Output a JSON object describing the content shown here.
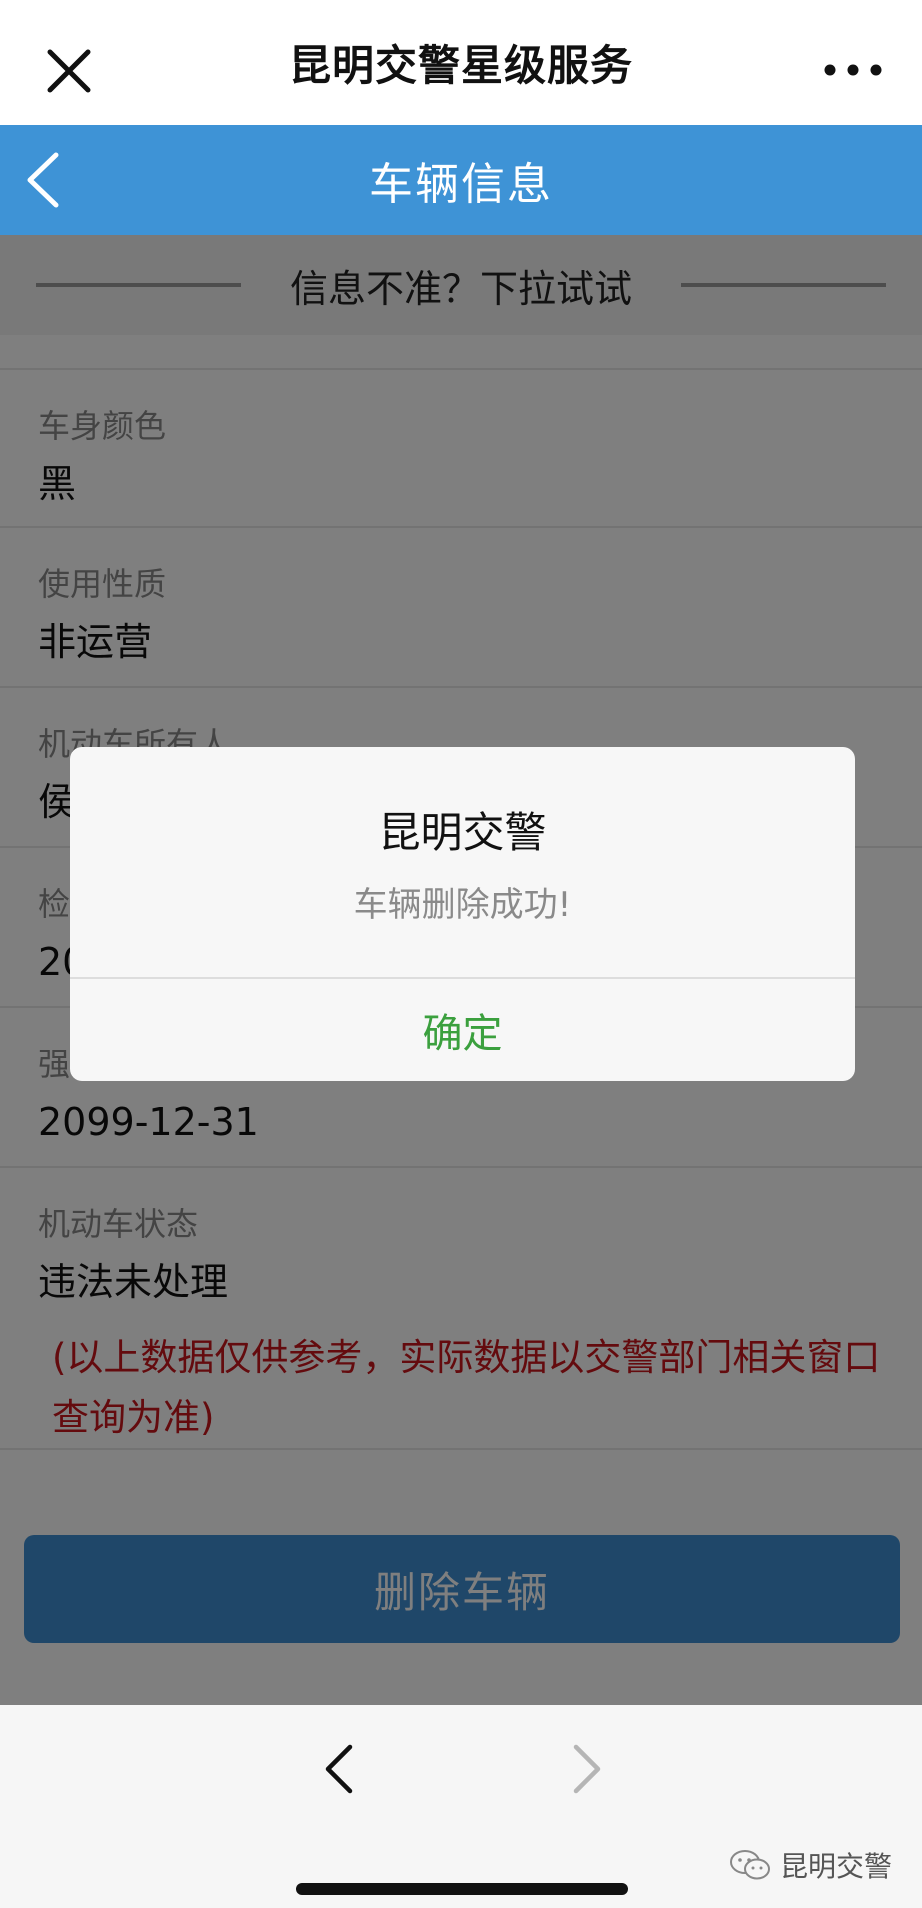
{
  "wechat_bar": {
    "title": "昆明交警星级服务"
  },
  "app_header": {
    "title": "车辆信息"
  },
  "pull_hint": "信息不准？下拉试试",
  "vehicle_info": {
    "items": [
      {
        "label": "车身颜色",
        "value": "黑"
      },
      {
        "label": "使用性质",
        "value": "非运营"
      },
      {
        "label": "机动车所有人",
        "value": "侯"
      },
      {
        "label": "检",
        "value": "20"
      },
      {
        "label": "强",
        "value": "2099-12-31"
      },
      {
        "label": "机动车状态",
        "value": "违法未处理"
      }
    ],
    "disclaimer": "(以上数据仅供参考，实际数据以交警部门相关窗口查询为准)"
  },
  "delete_button": {
    "label": "删除车辆"
  },
  "dialog": {
    "title": "昆明交警",
    "message": "车辆删除成功!",
    "confirm_label": "确定"
  },
  "watermark": {
    "text": "昆明交警"
  },
  "colors": {
    "header_blue": "#3e93d6",
    "confirm_green": "#3ba03e",
    "disclaimer_red": "#c8161d"
  }
}
